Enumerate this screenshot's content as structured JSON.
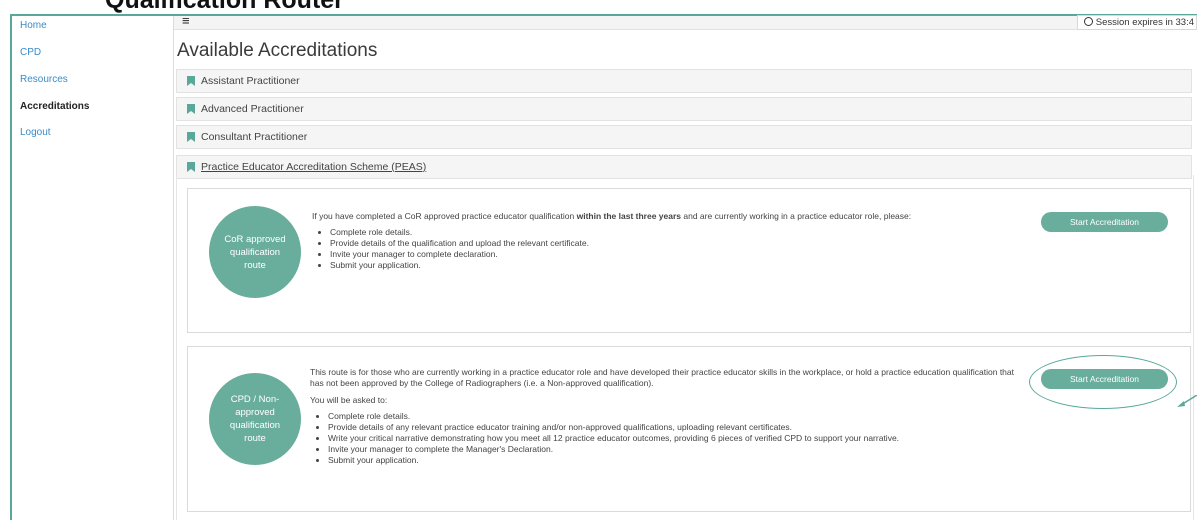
{
  "heading": "Qualification Router",
  "sidebar": {
    "items": [
      {
        "label": "Home",
        "active": false
      },
      {
        "label": "CPD",
        "active": false
      },
      {
        "label": "Resources",
        "active": false
      },
      {
        "label": "Accreditations",
        "active": true
      },
      {
        "label": "Logout",
        "active": false
      }
    ]
  },
  "topbar": {
    "menu_icon": "hamburger-icon",
    "session_text": "Session expires in 33:4"
  },
  "main": {
    "title": "Available Accreditations",
    "accreditations": [
      {
        "label": "Assistant Practitioner"
      },
      {
        "label": "Advanced Practitioner"
      },
      {
        "label": "Consultant Practitioner"
      },
      {
        "label": "Practice Educator Accreditation Scheme (PEAS)"
      }
    ],
    "routes": [
      {
        "circle": "CoR approved qualification route",
        "intro_before": "If you have completed a CoR approved practice educator qualification ",
        "intro_bold": "within the last three years",
        "intro_after": " and are currently working in a practice educator role, please:",
        "steps": [
          "Complete role details.",
          "Provide details of the qualification and upload the relevant certificate.",
          "Invite your manager to complete declaration.",
          "Submit your application."
        ],
        "button": "Start Accreditation"
      },
      {
        "circle": "CPD / Non-approved qualification route",
        "intro": "This route is for those who are currently working in a practice educator role and have developed their practice educator skills in the workplace, or hold a practice education qualification that has not been approved by the College of Radiographers (i.e. a Non-approved qualification).",
        "asked": "You will be asked to:",
        "steps": [
          "Complete role details.",
          "Provide details of any relevant practice educator training and/or non-approved qualifications, uploading relevant certificates.",
          "Write your critical narrative demonstrating how you meet all 12 practice educator outcomes, providing 6 pieces of verified CPD to support your narrative.",
          "Invite your manager to complete the Manager's Declaration.",
          "Submit your application."
        ],
        "button": "Start Accreditation"
      }
    ]
  },
  "colors": {
    "accent": "#69ad9c",
    "link": "#3a8cc7",
    "bookmark": "#5aa899"
  }
}
